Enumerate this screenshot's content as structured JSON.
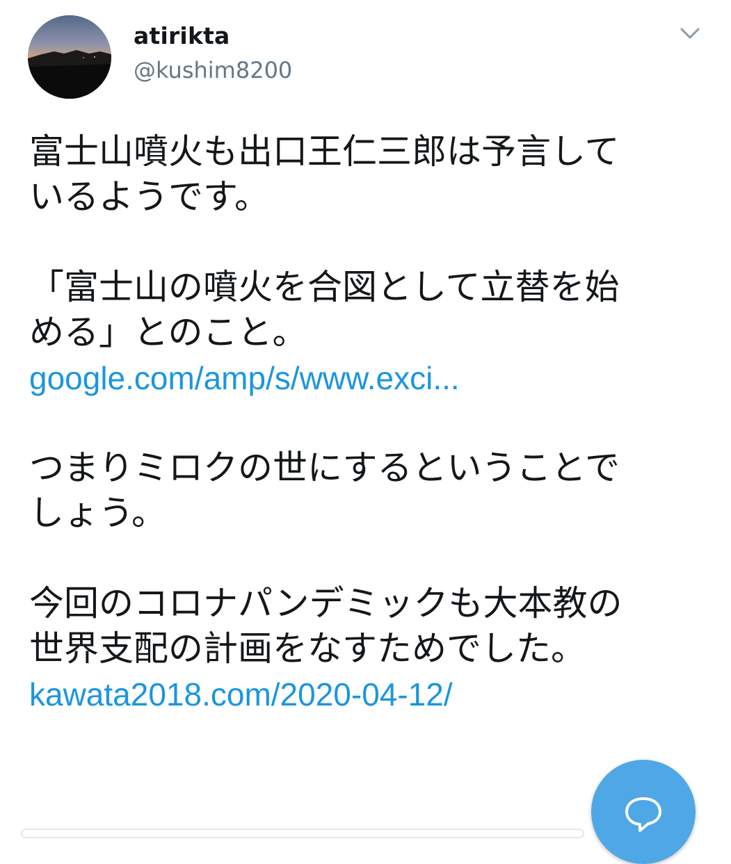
{
  "header": {
    "display_name": "atirikta",
    "handle": "@kushim8200",
    "avatar_icon": "profile-photo-dusk-landscape",
    "menu_icon": "chevron-down-icon"
  },
  "tweet": {
    "lines": [
      {
        "kind": "text",
        "text": "富士山噴火も出口王仁三郎は予言して"
      },
      {
        "kind": "text",
        "text": "いるようです。"
      },
      {
        "kind": "gap"
      },
      {
        "kind": "text",
        "text": "「富士山の噴火を合図として立替を始"
      },
      {
        "kind": "text",
        "text": "める」とのこと。"
      },
      {
        "kind": "link",
        "text": "google.com/amp/s/www.exci..."
      },
      {
        "kind": "gap"
      },
      {
        "kind": "text",
        "text": "つまりミロクの世にするということで"
      },
      {
        "kind": "text",
        "text": "しょう。"
      },
      {
        "kind": "gap"
      },
      {
        "kind": "text",
        "text": "今回のコロナパンデミックも大本教の"
      },
      {
        "kind": "text",
        "text": "世界支配の計画をなすためでした。"
      },
      {
        "kind": "link",
        "text": "kawata2018.com/2020-04-12/"
      }
    ]
  },
  "fab": {
    "icon": "reply-bubble-icon",
    "color": "#4fa7e6"
  },
  "colors": {
    "link": "#1b95e0",
    "text": "#14171a",
    "secondary": "#657786"
  }
}
